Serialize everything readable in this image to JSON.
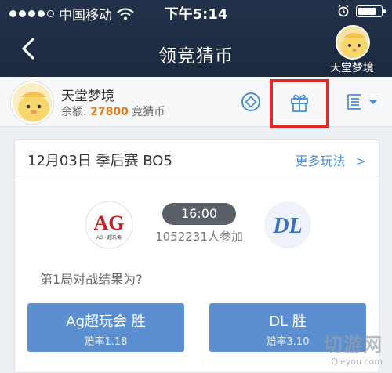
{
  "status_bar": {
    "carrier": "中国移动",
    "time": "下午5:14",
    "battery_level": 0.85
  },
  "nav": {
    "title": "领竞猜币",
    "user_name": "天堂梦境"
  },
  "profile": {
    "name": "天堂梦境",
    "balance_label": "余额:",
    "balance_amount": "27800",
    "balance_unit": "竞猜币"
  },
  "match": {
    "header": "12月03日 季后赛 BO5",
    "more_label": "更多玩法",
    "more_chevron": ">",
    "time": "16:00",
    "participants": "1052231人参加",
    "team_a_logo_text": "AG",
    "team_a_logo_sub": "AG · 超玩会",
    "team_b_logo_text": "DL",
    "question": "第1局对战结果为?",
    "options": [
      {
        "label": "Ag超玩会 胜",
        "odds": "赔率1.18"
      },
      {
        "label": "DL 胜",
        "odds": "赔率3.10"
      }
    ]
  },
  "watermark": {
    "text": "切游网",
    "sub": "Qieyou.com"
  },
  "colors": {
    "nav_bg": "#1c2a40",
    "accent_blue": "#5b8fd0",
    "link": "#4a8fd6",
    "highlight_red": "#e02a2a",
    "amount_orange": "#e07a1a"
  },
  "icons": [
    "signal-icon",
    "wifi-icon",
    "alarm-icon",
    "battery-icon",
    "back-icon",
    "coin-icon",
    "gift-icon",
    "list-icon",
    "dropdown-icon",
    "chevron-right-icon"
  ]
}
